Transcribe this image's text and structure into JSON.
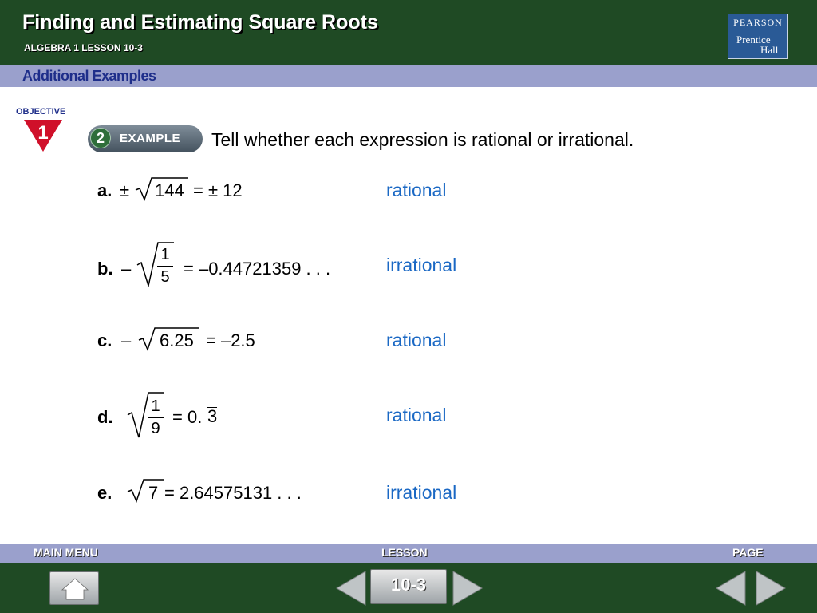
{
  "header": {
    "title": "Finding and Estimating Square Roots",
    "subtitle": "ALGEBRA 1  LESSON 10-3",
    "logo": {
      "line1": "PEARSON",
      "line2": "Prentice",
      "line3": "Hall"
    }
  },
  "section_bar": {
    "label": "Additional Examples"
  },
  "objective": {
    "label": "OBJECTIVE",
    "number": "1"
  },
  "example": {
    "number": "2",
    "label": "EXAMPLE",
    "prompt": "Tell whether each expression is rational or irrational."
  },
  "items": {
    "a": {
      "letter": "a.",
      "sign": "±",
      "radicand": "144",
      "rhs": "= ± 12",
      "answer": "rational"
    },
    "b": {
      "letter": "b.",
      "sign": "–",
      "numerator": "1",
      "denominator": "5",
      "rhs": "= –0.44721359 . . .",
      "answer": "irrational"
    },
    "c": {
      "letter": "c.",
      "sign": "–",
      "radicand": "6.25",
      "rhs": "= –2.5",
      "answer": "rational"
    },
    "d": {
      "letter": "d.",
      "numerator": "1",
      "denominator": "9",
      "rhs_prefix": "= 0.",
      "rhs_repeat": "3",
      "answer": "rational"
    },
    "e": {
      "letter": "e.",
      "radicand": "7",
      "rhs": "= 2.64575131 . . .",
      "answer": "irrational"
    }
  },
  "footer": {
    "main_menu": "MAIN MENU",
    "lesson": "LESSON",
    "page": "PAGE",
    "lesson_button": "10-3"
  },
  "colors": {
    "header_green": "#1f4a24",
    "bar_lavender": "#9aa0cc",
    "answer_blue": "#1a68c4",
    "objective_red": "#d0102a"
  }
}
